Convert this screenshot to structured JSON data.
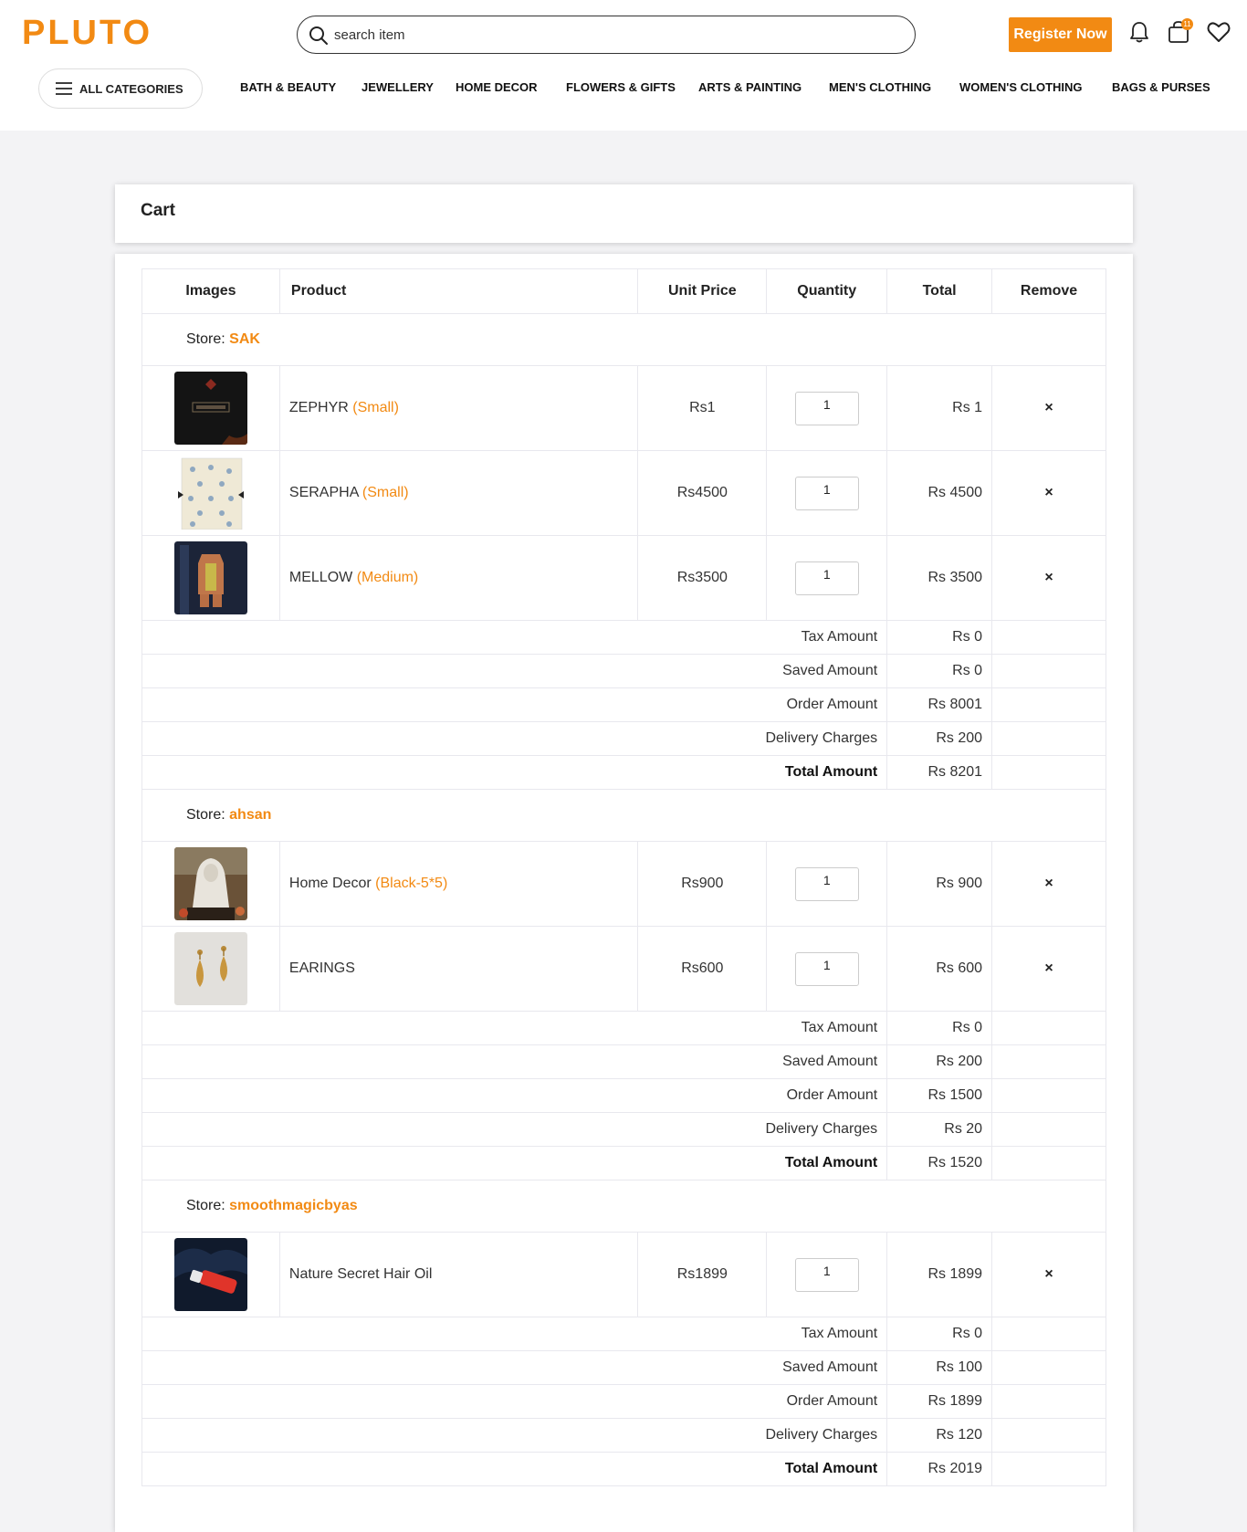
{
  "header": {
    "logo_text": "PLUTO",
    "search_placeholder": "search item",
    "register_label": "Register Now",
    "cart_count": "11",
    "all_categories": "ALL CATEGORIES",
    "nav": [
      "BATH & BEAUTY",
      "JEWELLERY",
      "HOME DECOR",
      "FLOWERS & GIFTS",
      "ARTS & PAINTING",
      "MEN'S CLOTHING",
      "WOMEN'S CLOTHING",
      "BAGS & PURSES"
    ]
  },
  "cart": {
    "title": "Cart",
    "columns": [
      "Images",
      "Product",
      "Unit Price",
      "Quantity",
      "Total",
      "Remove"
    ],
    "store_prefix": "Store: ",
    "remove_glyph": "×",
    "stores": [
      {
        "name": "SAK",
        "items": [
          {
            "name": "ZEPHYR ",
            "variant": "(Small)",
            "unit_price": "Rs1",
            "qty": "1",
            "total": "Rs 1"
          },
          {
            "name": "SERAPHA ",
            "variant": "(Small)",
            "unit_price": "Rs4500",
            "qty": "1",
            "total": "Rs 4500"
          },
          {
            "name": "MELLOW ",
            "variant": "(Medium)",
            "unit_price": "Rs3500",
            "qty": "1",
            "total": "Rs 3500"
          }
        ],
        "summary": [
          {
            "label": "Tax Amount",
            "value": "Rs 0"
          },
          {
            "label": "Saved Amount",
            "value": "Rs 0"
          },
          {
            "label": "Order Amount",
            "value": "Rs 8001"
          },
          {
            "label": "Delivery Charges",
            "value": "Rs 200"
          },
          {
            "label": "Total Amount",
            "value": "Rs 8201"
          }
        ]
      },
      {
        "name": "ahsan",
        "items": [
          {
            "name": "Home Decor ",
            "variant": "(Black-5*5)",
            "unit_price": "Rs900",
            "qty": "1",
            "total": "Rs 900"
          },
          {
            "name": "EARINGS",
            "variant": "",
            "unit_price": "Rs600",
            "qty": "1",
            "total": "Rs 600"
          }
        ],
        "summary": [
          {
            "label": "Tax Amount",
            "value": "Rs 0"
          },
          {
            "label": "Saved Amount",
            "value": "Rs 200"
          },
          {
            "label": "Order Amount",
            "value": "Rs 1500"
          },
          {
            "label": "Delivery Charges",
            "value": "Rs 20"
          },
          {
            "label": "Total Amount",
            "value": "Rs 1520"
          }
        ]
      },
      {
        "name": "smoothmagicbyas",
        "items": [
          {
            "name": "Nature Secret Hair Oil",
            "variant": "",
            "unit_price": "Rs1899",
            "qty": "1",
            "total": "Rs 1899"
          }
        ],
        "summary": [
          {
            "label": "Tax Amount",
            "value": "Rs 0"
          },
          {
            "label": "Saved Amount",
            "value": "Rs 100"
          },
          {
            "label": "Order Amount",
            "value": "Rs 1899"
          },
          {
            "label": "Delivery Charges",
            "value": "Rs 120"
          },
          {
            "label": "Total Amount",
            "value": "Rs 2019"
          }
        ]
      }
    ]
  },
  "colors": {
    "accent": "#f28a13"
  }
}
